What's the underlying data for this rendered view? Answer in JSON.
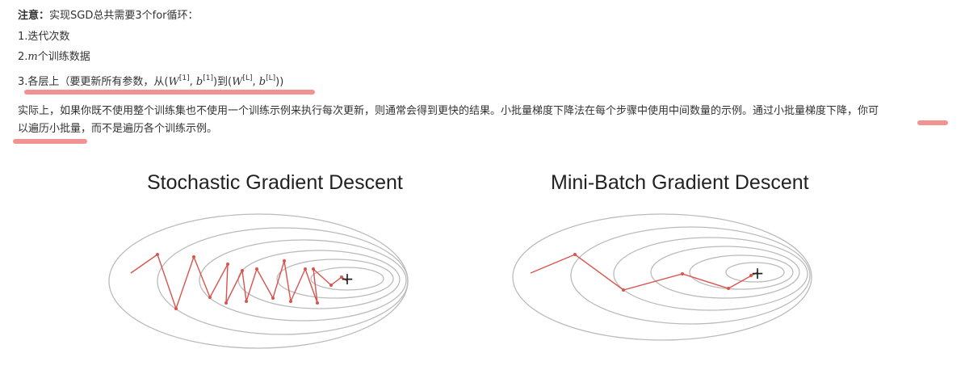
{
  "note": {
    "prefix": "注意：",
    "text": "实现SGD总共需要3个for循环：",
    "items": [
      {
        "label": "1.迭代次数"
      },
      {
        "label_pre": "2.",
        "math": "m",
        "label_post": "个训练数据"
      },
      {
        "label_pre": "3.各层上（要更新所有参数，从(",
        "w1": "W",
        "sup1": "[1]",
        "b1": "b",
        "sup1b": "[1]",
        "mid": ")到(",
        "wl": "W",
        "supl": "[L]",
        "bl": "b",
        "suplb": "[L]",
        "end": "))"
      }
    ]
  },
  "paragraph": {
    "line1": "实际上，如果你既不使用整个训练集也不使用一个训练示例来执行每次更新，则通常会得到更快的结果。小批量梯度下降法在每个步骤中使用中间数量的示例。通过小批量梯度下降，你可",
    "line2": "以遍历小批量，而不是遍历各个训练示例。"
  },
  "figures": [
    {
      "title": "Stochastic Gradient Descent",
      "minimum_marker": "+"
    },
    {
      "title": "Mini-Batch Gradient Descent",
      "minimum_marker": "+"
    }
  ],
  "colors": {
    "highlight": "#f08080",
    "path": "#d9534f",
    "contour": "#bbbbbb"
  }
}
